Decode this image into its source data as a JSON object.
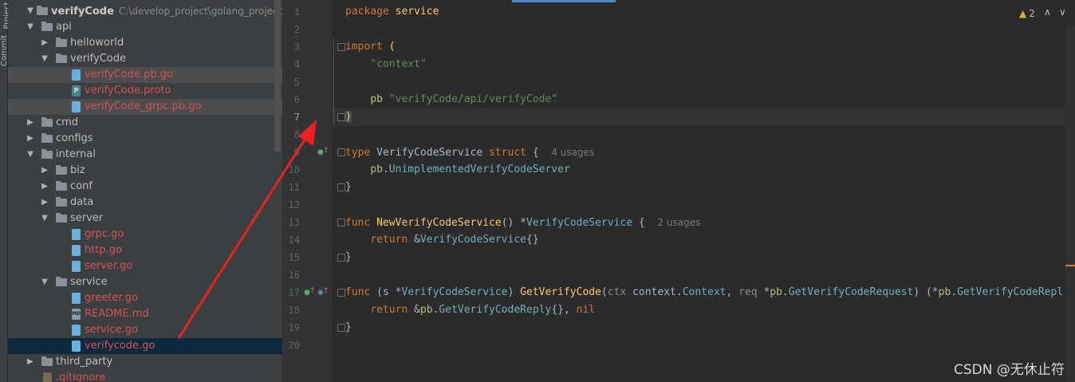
{
  "toolstrip": {
    "project_label": "Project",
    "commit_label": "Commit"
  },
  "tree": {
    "root": {
      "name": "verifyCode",
      "path": "C:\\develop_project\\golang_project\\laon"
    },
    "items": [
      {
        "label": "api"
      },
      {
        "label": "helloworld"
      },
      {
        "label": "verifyCode"
      },
      {
        "label": "verifyCode.pb.go"
      },
      {
        "label": "verifyCode.proto"
      },
      {
        "label": "verifyCode_grpc.pb.go"
      },
      {
        "label": "cmd"
      },
      {
        "label": "configs"
      },
      {
        "label": "internal"
      },
      {
        "label": "biz"
      },
      {
        "label": "conf"
      },
      {
        "label": "data"
      },
      {
        "label": "server"
      },
      {
        "label": "grpc.go"
      },
      {
        "label": "http.go"
      },
      {
        "label": "server.go"
      },
      {
        "label": "service"
      },
      {
        "label": "greeter.go"
      },
      {
        "label": "README.md"
      },
      {
        "label": "service.go"
      },
      {
        "label": "verifycode.go"
      },
      {
        "label": "third_party"
      },
      {
        "label": ".gitignore"
      }
    ],
    "icons": {
      "proto": "P",
      "md": "MD"
    }
  },
  "editor": {
    "line_numbers": [
      "1",
      "2",
      "3",
      "4",
      "5",
      "6",
      "7",
      "8",
      "9",
      "10",
      "11",
      "12",
      "13",
      "14",
      "15",
      "16",
      "17",
      "18",
      "19",
      "20"
    ],
    "l1": {
      "kw": "package",
      "name": "service"
    },
    "l3": {
      "kw": "import",
      "paren": "("
    },
    "l4": {
      "str": "\"context\""
    },
    "l6": {
      "alias": "pb",
      "str": "\"verifyCode/api/verifyCode\""
    },
    "l7": {
      "paren": ")"
    },
    "l9": {
      "kw": "type",
      "name": "VerifyCodeService",
      "kw2": "struct",
      "brace": "{",
      "hint": "4 usages"
    },
    "l10": {
      "pkg": "pb.",
      "type": "UnimplementedVerifyCodeServer"
    },
    "l11": {
      "brace": "}"
    },
    "l13": {
      "kw": "func",
      "name": "NewVerifyCodeService",
      "sig": "() *",
      "type": "VerifyCodeService",
      "brace": " {",
      "hint": "2 usages"
    },
    "l14": {
      "kw": "return",
      "amp": " &",
      "type": "VerifyCodeService",
      "tail": "{}"
    },
    "l15": {
      "brace": "}"
    },
    "l17": {
      "kw": "func",
      "recv_open": " (s *",
      "recv_type": "VerifyCodeService",
      "recv_close": ") ",
      "name": "GetVerifyCode",
      "p_open": "(",
      "p1": "ctx",
      "p1_pkg": " context.",
      "p1_type": "Context",
      "comma": ", ",
      "p2": "req",
      "p2_star": " *",
      "p2_pkg": "pb.",
      "p2_type": "GetVerifyCodeRequest",
      "ret_open": ") (*",
      "ret_pkg": "pb.",
      "ret_type": "GetVerifyCodeRepl"
    },
    "l18": {
      "kw": "return",
      "amp": " &",
      "pkg": "pb.",
      "type": "GetVerifyCodeReply",
      "tail": "{}, ",
      "nil": "nil"
    },
    "l19": {
      "brace": "}"
    }
  },
  "status": {
    "warnings": "2",
    "up": "∧",
    "down": "∨"
  },
  "watermark": "CSDN @无休止符",
  "colors": {
    "accent": "#4a88c7",
    "keyword": "#cc7832",
    "string": "#6a8759",
    "function": "#ffc66d",
    "error_file": "#d25252"
  }
}
